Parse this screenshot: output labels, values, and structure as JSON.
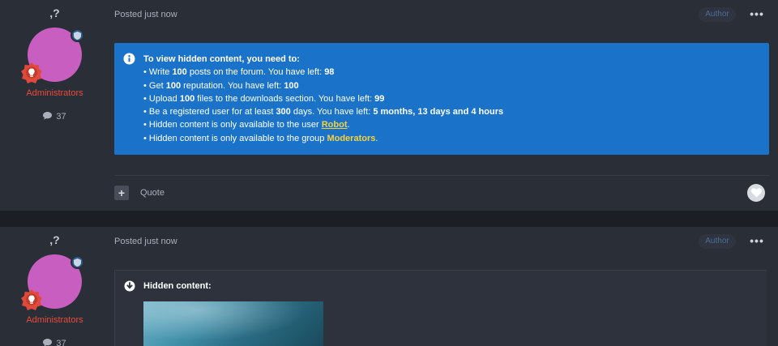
{
  "posts": [
    {
      "author": {
        "username": ",?",
        "group": "Administrators",
        "post_count": "37"
      },
      "meta": {
        "posted": "Posted just now",
        "author_tag": "Author"
      },
      "hidden_info": {
        "title": "To view hidden content, you need to:",
        "lines": [
          {
            "prefix": "• Write ",
            "bold1": "100",
            "mid": " posts on the forum. You have left: ",
            "bold2": "98",
            "suffix": ""
          },
          {
            "prefix": "• Get ",
            "bold1": "100",
            "mid": " reputation. You have left: ",
            "bold2": "100",
            "suffix": ""
          },
          {
            "prefix": "• Upload ",
            "bold1": "100",
            "mid": " files to the downloads section. You have left: ",
            "bold2": "99",
            "suffix": ""
          },
          {
            "prefix": "• Be a registered user for at least ",
            "bold1": "300",
            "mid": " days. You have left: ",
            "bold2": "5 months, 13 days and 4 hours",
            "suffix": ""
          }
        ],
        "user_line": {
          "prefix": "• Hidden content is only available to the user ",
          "link": "Robot",
          "suffix": "."
        },
        "group_line": {
          "prefix": "• Hidden content is only available to the group ",
          "link": "Moderators",
          "suffix": "."
        }
      },
      "actions": {
        "plus": "+",
        "quote": "Quote"
      }
    },
    {
      "author": {
        "username": ",?",
        "group": "Administrators",
        "post_count": "37"
      },
      "meta": {
        "posted": "Posted just now",
        "author_tag": "Author"
      },
      "hidden_content": {
        "title": "Hidden content:"
      }
    }
  ],
  "colors": {
    "info_bg": "#1b73c9",
    "group": "#e84b3d",
    "link": "#f4d13d",
    "avatar": "#c85fc0"
  }
}
